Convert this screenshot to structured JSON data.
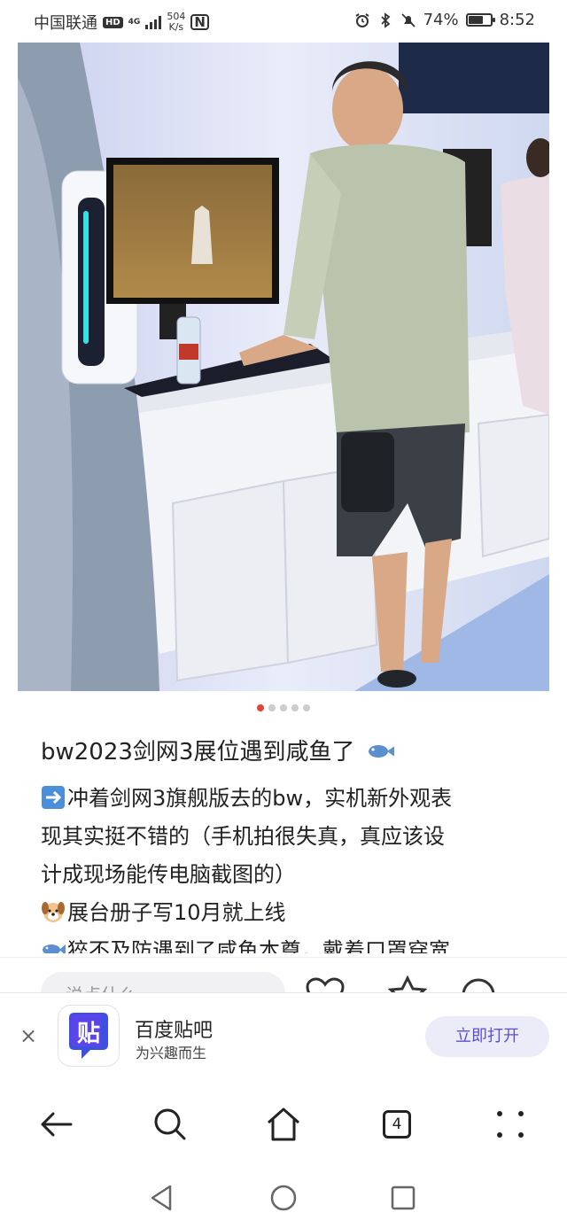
{
  "status_bar": {
    "carrier": "中国联通",
    "hd": "HD",
    "network": "4G",
    "speed_value": "504",
    "speed_unit": "K/s",
    "nfc": "N",
    "battery_percent": "74%",
    "battery_level": 0.74,
    "time": "8:52",
    "icons": [
      "alarm-icon",
      "bluetooth-icon",
      "mute-icon",
      "battery-icon"
    ]
  },
  "post": {
    "image_count": 5,
    "active_image": 0,
    "title": "bw2023剑网3展位遇到咸鱼了",
    "lines": [
      {
        "icon": "arrow-right-emoji",
        "text": "冲着剑网3旗舰版去的bw，实机新外观表"
      },
      {
        "icon": "",
        "text": "现其实挺不错的（手机拍很失真，真应该设"
      },
      {
        "icon": "",
        "text": "计成现场能传电脑截图的）"
      },
      {
        "icon": "dog-emoji",
        "text": "展台册子写10月就上线"
      },
      {
        "icon": "fish-emoji",
        "text": "猝不及防遇到了咸鱼本尊，戴着口罩穿宽"
      }
    ],
    "comment_placeholder": "说点什么"
  },
  "app_banner": {
    "close": "×",
    "icon_char": "贴",
    "name": "百度贴吧",
    "slogan": "为兴趣而生",
    "open_button": "立即打开"
  },
  "browser_nav": {
    "tab_count": "4",
    "items": [
      "back-icon",
      "search-icon",
      "home-icon",
      "tabs-icon",
      "more-icon"
    ]
  },
  "colors": {
    "accent": "#5a4fd6",
    "active_dot": "#e0433a",
    "open_button_bg": "#ececf8"
  }
}
